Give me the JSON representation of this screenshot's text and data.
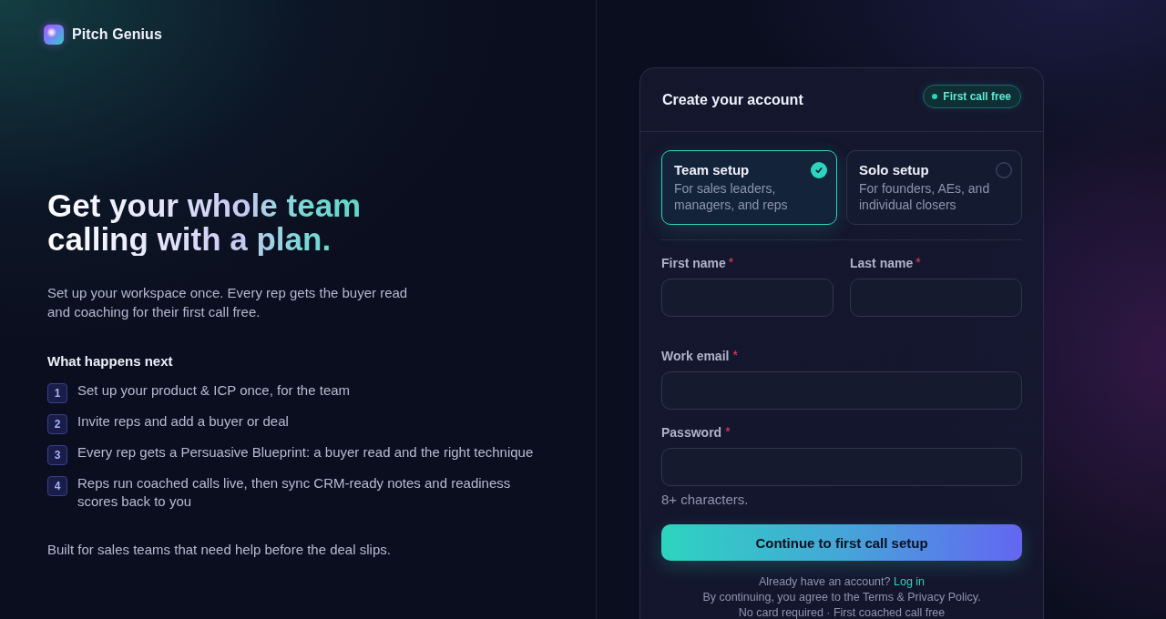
{
  "brand": {
    "name": "Pitch Genius"
  },
  "hero": {
    "heading_lines": [
      "Get your whole team",
      "calling with a plan."
    ],
    "subtitle": "Set up your workspace once. Every rep gets the buyer read and coaching for their first call free.",
    "steps_title": "What happens next",
    "steps": [
      {
        "number": "1",
        "text": "Set up your product & ICP once, for the team"
      },
      {
        "number": "2",
        "text": "Invite reps and add a buyer or deal"
      },
      {
        "number": "3",
        "text": "Every rep gets a Persuasive Blueprint: a buyer read and the right technique"
      },
      {
        "number": "4",
        "text": "Reps run coached calls live, then sync CRM-ready notes and readiness scores back to you"
      }
    ],
    "footnote": "Built for sales teams that need help before the deal slips."
  },
  "signup_card": {
    "title": "Create your account",
    "badge": "First call free",
    "setup_options": [
      {
        "title": "Team setup",
        "description": "For sales leaders, managers, and reps",
        "selected": true
      },
      {
        "title": "Solo setup",
        "description": "For founders, AEs, and individual closers",
        "selected": false
      }
    ],
    "name_fields": [
      {
        "label": "First name",
        "required_mark": "*"
      },
      {
        "label": "Last name",
        "required_mark": "*"
      }
    ],
    "fields": [
      {
        "label": "Work email",
        "required_mark": "*"
      },
      {
        "label": "Password",
        "required_mark": "*",
        "hint": "8+ characters."
      }
    ],
    "submit_button": "Continue to first call setup",
    "login_prompt": {
      "text": "Already have an account?",
      "link": "Log in"
    },
    "terms": "By continuing, you agree to the Terms & Privacy Policy.",
    "note": "No card required · First coached call free"
  }
}
